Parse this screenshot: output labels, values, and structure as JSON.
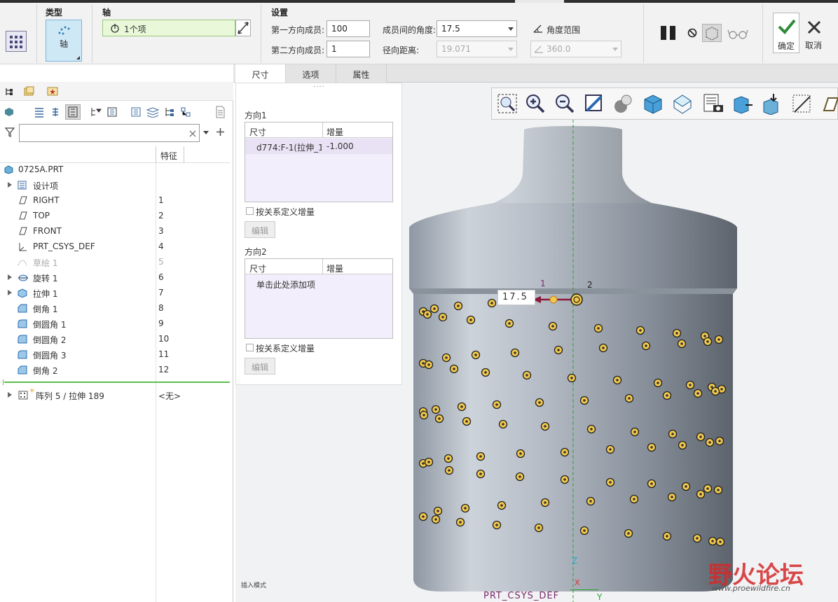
{
  "ribbon": {
    "type_label": "类型",
    "type_value": "轴",
    "axis_label": "轴",
    "axis_value": "1个项",
    "settings_label": "设置",
    "dir1_members_label": "第一方向成员:",
    "dir1_members_value": "100",
    "dir2_members_label": "第二方向成员:",
    "dir2_members_value": "1",
    "angle_label": "成员间的角度:",
    "angle_value": "17.5",
    "radial_label": "径向距离:",
    "radial_value": "19.071",
    "angle_range_label": "角度范围",
    "angle_range_value": "360.0",
    "ok_label": "确定",
    "cancel_label": "取消"
  },
  "tabs": [
    "尺寸",
    "选项",
    "属性"
  ],
  "model_tree": {
    "filter_placeholder": "",
    "column_header": "特征",
    "root": "0725A.PRT",
    "items": [
      {
        "name": "设计项",
        "num": "",
        "expand": true,
        "icon": "design-items-icon",
        "dim": false
      },
      {
        "name": "RIGHT",
        "num": "1",
        "expand": false,
        "icon": "datum-plane-icon",
        "dim": false
      },
      {
        "name": "TOP",
        "num": "2",
        "expand": false,
        "icon": "datum-plane-icon",
        "dim": false
      },
      {
        "name": "FRONT",
        "num": "3",
        "expand": false,
        "icon": "datum-plane-icon",
        "dim": false
      },
      {
        "name": "PRT_CSYS_DEF",
        "num": "4",
        "expand": false,
        "icon": "csys-icon",
        "dim": false
      },
      {
        "name": "草绘 1",
        "num": "5",
        "expand": false,
        "icon": "sketch-icon",
        "dim": true
      },
      {
        "name": "旋转 1",
        "num": "6",
        "expand": true,
        "icon": "revolve-icon",
        "dim": false
      },
      {
        "name": "拉伸 1",
        "num": "7",
        "expand": true,
        "icon": "extrude-icon",
        "dim": false
      },
      {
        "name": "倒角 1",
        "num": "8",
        "expand": false,
        "icon": "chamfer-icon",
        "dim": false
      },
      {
        "name": "倒圆角 1",
        "num": "9",
        "expand": false,
        "icon": "round-icon",
        "dim": false
      },
      {
        "name": "倒圆角 2",
        "num": "10",
        "expand": false,
        "icon": "round-icon",
        "dim": false
      },
      {
        "name": "倒圆角 3",
        "num": "11",
        "expand": false,
        "icon": "round-icon",
        "dim": false
      },
      {
        "name": "倒角 2",
        "num": "12",
        "expand": false,
        "icon": "chamfer-icon",
        "dim": false
      }
    ],
    "pattern_item": {
      "name": "阵列 5 / 拉伸 189",
      "num": "<无>"
    }
  },
  "dimensions_panel": {
    "dir1_title": "方向1",
    "col_dim": "尺寸",
    "col_inc": "增量",
    "dir1_row_dim": "d774:F-1(拉伸_1(",
    "dir1_row_inc": "-1.000",
    "define_inc_label": "按关系定义增量",
    "edit_label": "编辑",
    "dir2_title": "方向2",
    "dir2_add_hint": "单击此处添加项",
    "define_inc_label2": "按关系定义增量",
    "edit_label2": "编辑"
  },
  "viewport": {
    "dim_callout": "17.5",
    "marker_1": "1",
    "marker_2": "2",
    "csys_label": "PRT_CSYS_DEF",
    "axis_z": "Z",
    "axis_x": "X",
    "axis_y": "Y",
    "insert_mode": "插入模式",
    "watermark_main": "野火论坛",
    "watermark_url": "www.proewildfire.cn"
  }
}
